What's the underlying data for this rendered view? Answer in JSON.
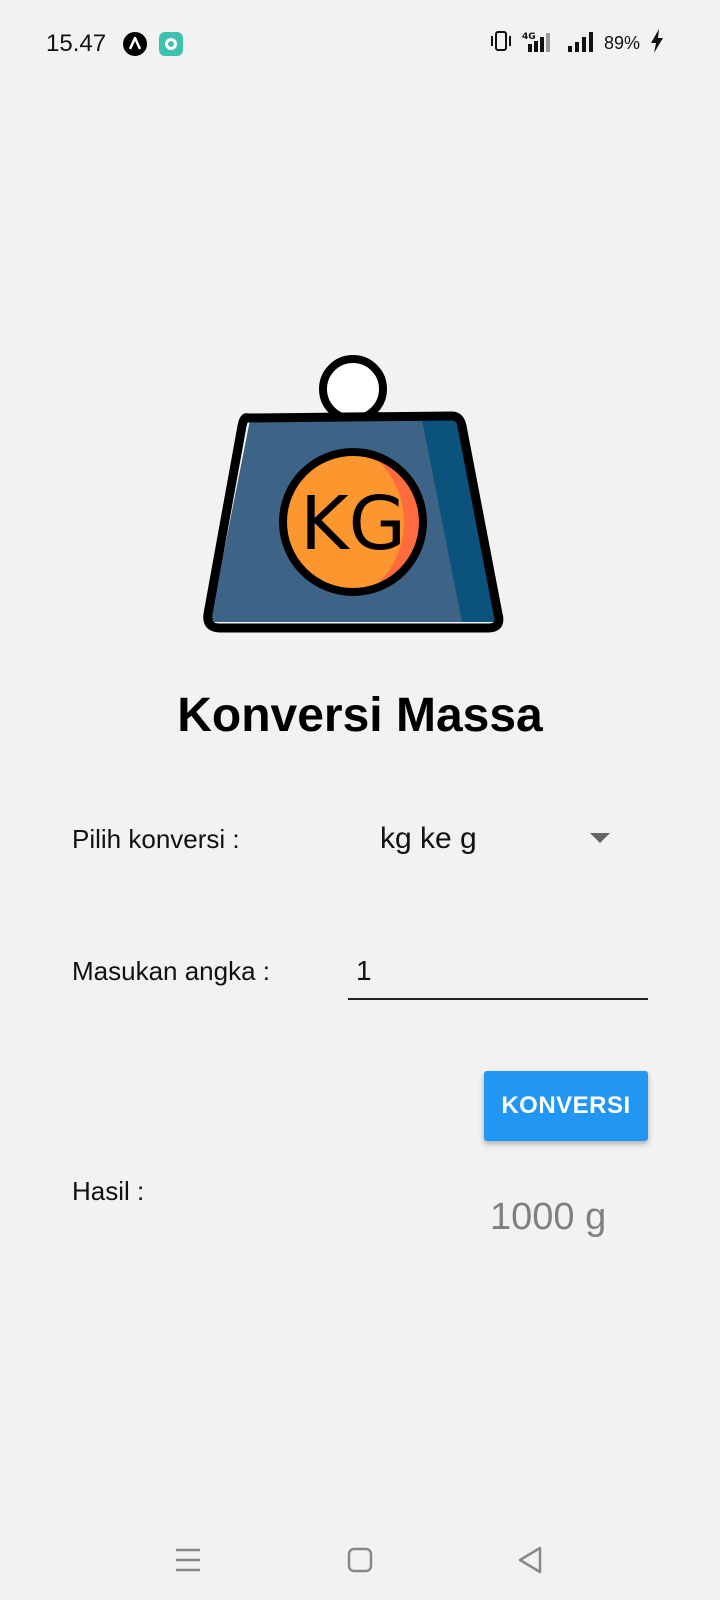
{
  "status_bar": {
    "time": "15.47",
    "battery": "89%",
    "network": "4G"
  },
  "logo": {
    "text": "KG"
  },
  "title": "Konversi Massa",
  "form": {
    "convert_label": "Pilih konversi :",
    "convert_selected": "kg ke g",
    "input_label": "Masukan angka :",
    "input_value": "1",
    "button_label": "KONVERSI",
    "result_label": "Hasil :",
    "result_value": "1000 g"
  },
  "colors": {
    "background": "#f2f2f2",
    "button": "#2196f3",
    "result_text": "#808080",
    "logo_body": "#3d6486",
    "logo_circle": "#fc962f"
  }
}
